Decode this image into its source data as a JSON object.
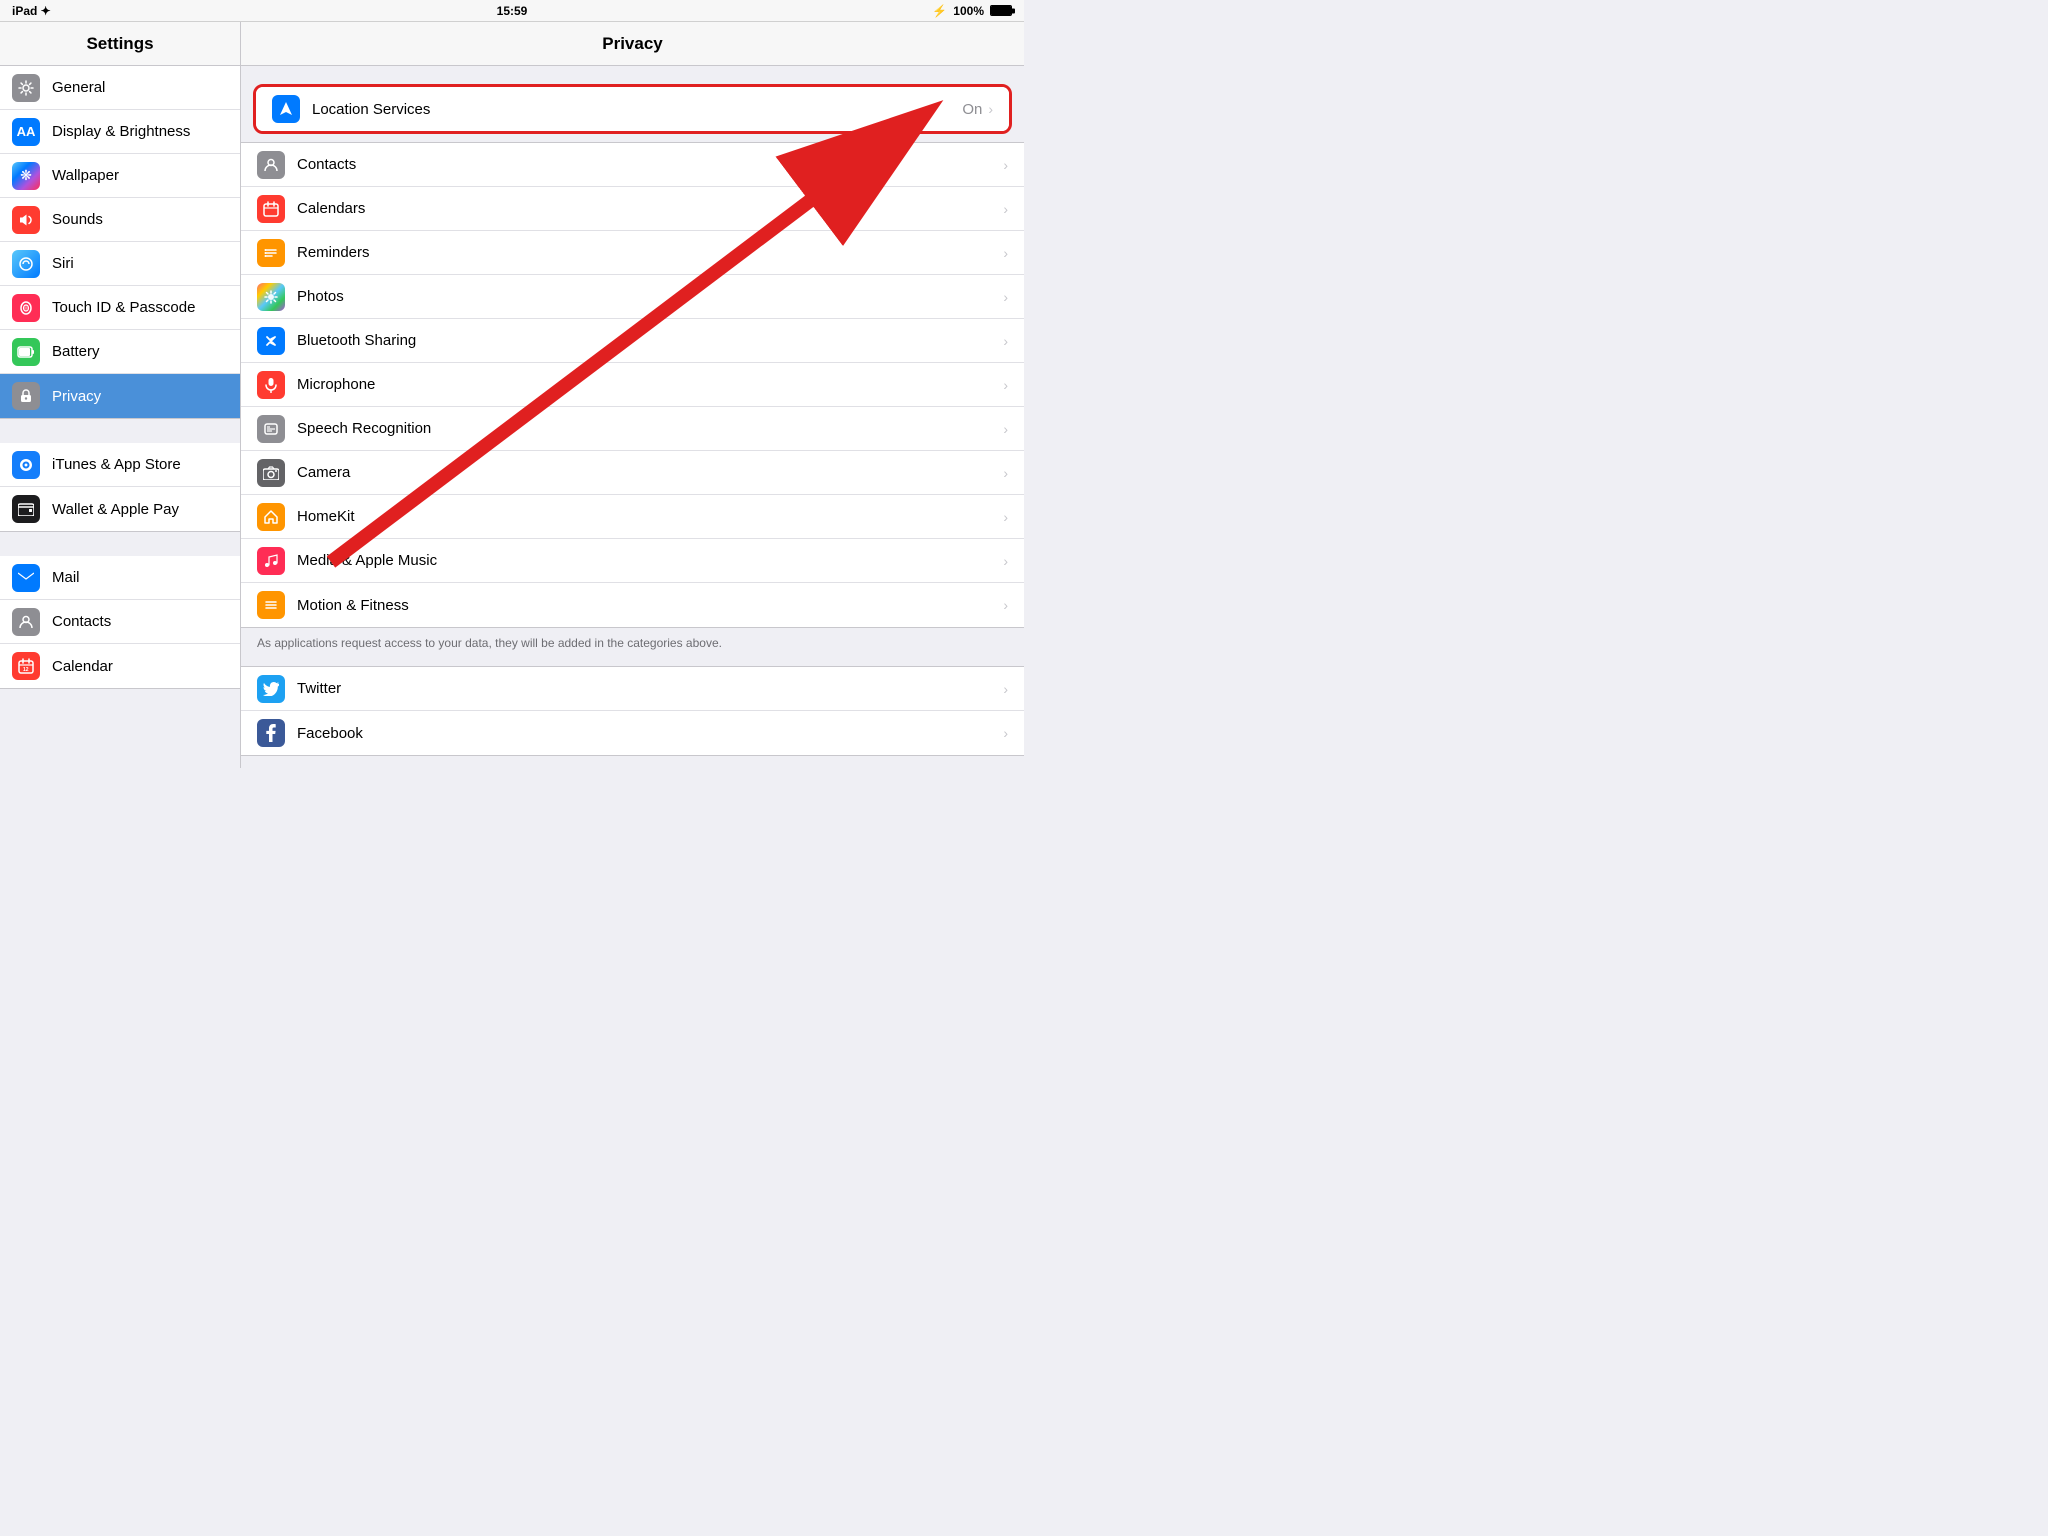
{
  "statusBar": {
    "left": "iPad ✦",
    "center": "15:59",
    "bluetooth": "B",
    "battery": "100%"
  },
  "sidebar": {
    "title": "Settings",
    "items": [
      {
        "id": "general",
        "label": "General",
        "iconBg": "icon-gray",
        "iconChar": "⚙️",
        "active": false
      },
      {
        "id": "display",
        "label": "Display & Brightness",
        "iconBg": "icon-blue",
        "iconChar": "A",
        "active": false
      },
      {
        "id": "wallpaper",
        "label": "Wallpaper",
        "iconBg": "icon-teal",
        "iconChar": "❋",
        "active": false
      },
      {
        "id": "sounds",
        "label": "Sounds",
        "iconBg": "icon-red",
        "iconChar": "🔊",
        "active": false
      },
      {
        "id": "siri",
        "label": "Siri",
        "iconBg": "icon-light-blue",
        "iconChar": "◎",
        "active": false
      },
      {
        "id": "touchid",
        "label": "Touch ID & Passcode",
        "iconBg": "icon-pink",
        "iconChar": "◉",
        "active": false
      },
      {
        "id": "battery",
        "label": "Battery",
        "iconBg": "icon-green",
        "iconChar": "▬",
        "active": false
      },
      {
        "id": "privacy",
        "label": "Privacy",
        "iconBg": "icon-gray",
        "iconChar": "✋",
        "active": true
      }
    ],
    "items2": [
      {
        "id": "itunes",
        "label": "iTunes & App Store",
        "iconBg": "icon-blue",
        "iconChar": "A",
        "active": false
      },
      {
        "id": "wallet",
        "label": "Wallet & Apple Pay",
        "iconBg": "icon-dark-gray",
        "iconChar": "▤",
        "active": false
      }
    ],
    "items3": [
      {
        "id": "mail",
        "label": "Mail",
        "iconBg": "icon-blue",
        "iconChar": "✉",
        "active": false
      },
      {
        "id": "contacts",
        "label": "Contacts",
        "iconBg": "icon-contacts-gray",
        "iconChar": "👤",
        "active": false
      },
      {
        "id": "calendar",
        "label": "Calendar",
        "iconBg": "icon-red",
        "iconChar": "📅",
        "active": false
      }
    ]
  },
  "content": {
    "title": "Privacy",
    "locationServices": {
      "label": "Location Services",
      "value": "On",
      "iconBg": "#007aff"
    },
    "items": [
      {
        "id": "contacts",
        "label": "Contacts",
        "iconBg": "#8e8e93",
        "iconChar": "👤"
      },
      {
        "id": "calendars",
        "label": "Calendars",
        "iconBg": "#ff3b30",
        "iconChar": "📅"
      },
      {
        "id": "reminders",
        "label": "Reminders",
        "iconBg": "#ff9500",
        "iconChar": "≡"
      },
      {
        "id": "photos",
        "label": "Photos",
        "iconBg": "#5ac8fa",
        "iconChar": "⬡"
      },
      {
        "id": "bluetooth",
        "label": "Bluetooth Sharing",
        "iconBg": "#007aff",
        "iconChar": "Ƀ"
      },
      {
        "id": "microphone",
        "label": "Microphone",
        "iconBg": "#ff3b30",
        "iconChar": "🎙"
      },
      {
        "id": "speech",
        "label": "Speech Recognition",
        "iconBg": "#8e8e93",
        "iconChar": "🎵"
      },
      {
        "id": "camera",
        "label": "Camera",
        "iconBg": "#636366",
        "iconChar": "📷"
      },
      {
        "id": "homekit",
        "label": "HomeKit",
        "iconBg": "#ff9500",
        "iconChar": "⌂"
      },
      {
        "id": "media",
        "label": "Media & Apple Music",
        "iconBg": "#ff2d55",
        "iconChar": "♪"
      },
      {
        "id": "motion",
        "label": "Motion & Fitness",
        "iconBg": "#ff9500",
        "iconChar": "≡"
      }
    ],
    "footerNote": "As applications request access to your data, they will be added in the categories above.",
    "bottomItems": [
      {
        "id": "twitter",
        "label": "Twitter",
        "iconBg": "#1da1f2",
        "iconChar": "🐦"
      },
      {
        "id": "facebook",
        "label": "Facebook",
        "iconBg": "#3b5998",
        "iconChar": "f"
      }
    ]
  }
}
